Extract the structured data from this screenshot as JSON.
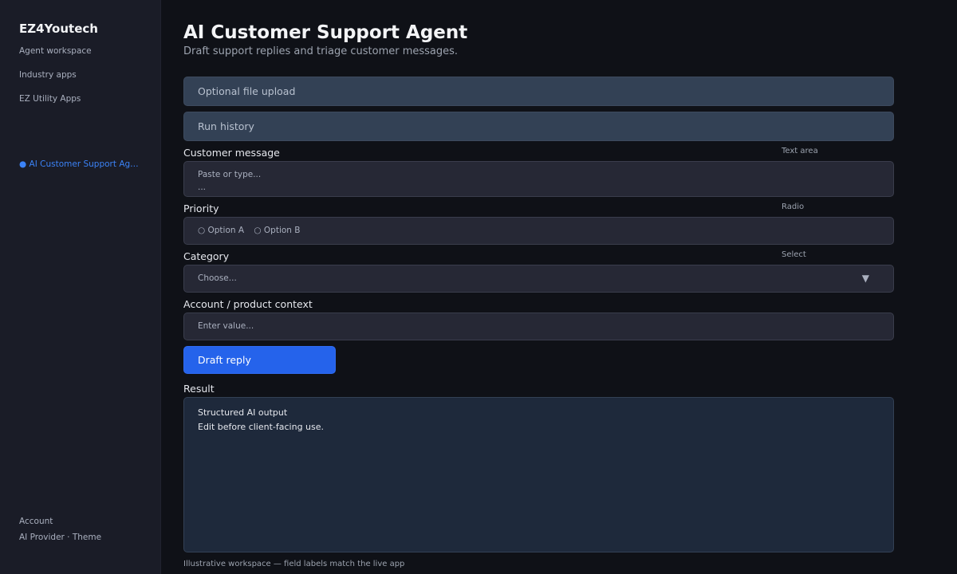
{
  "sidebar": {
    "brand": "EZ4Youtech",
    "nav": [
      {
        "label": "Agent workspace"
      },
      {
        "label": "Industry apps"
      },
      {
        "label": "EZ Utility Apps"
      }
    ],
    "active_item": {
      "bullet": "●",
      "label": "AI Customer Support Agent"
    },
    "footer": {
      "account": "Account",
      "provider_theme": "AI Provider · Theme"
    }
  },
  "header": {
    "title": "AI Customer Support Agent",
    "subtitle": "Draft support replies and triage customer messages."
  },
  "expanders": {
    "file_upload": "Optional file upload",
    "run_history": "Run history"
  },
  "fields": {
    "customer_message": {
      "label": "Customer message",
      "type": "Text area",
      "placeholder": "Paste or type...",
      "ellipsis": "..."
    },
    "priority": {
      "label": "Priority",
      "type": "Radio",
      "option_a": "○ Option A",
      "option_b": "○ Option B"
    },
    "category": {
      "label": "Category",
      "type": "Select",
      "placeholder": "Choose...",
      "caret": "▼"
    },
    "account_context": {
      "label": "Account / product context",
      "placeholder": "Enter value..."
    }
  },
  "actions": {
    "draft_reply": "Draft reply"
  },
  "result": {
    "label": "Result",
    "line1": "Structured AI output",
    "line2": "Edit before client-facing use."
  },
  "footnote": "Illustrative workspace — field labels match the live app",
  "colors": {
    "accent": "#2563eb",
    "active_nav": "#3b82f6",
    "background": "#0f1117",
    "sidebar": "#1a1c27"
  }
}
